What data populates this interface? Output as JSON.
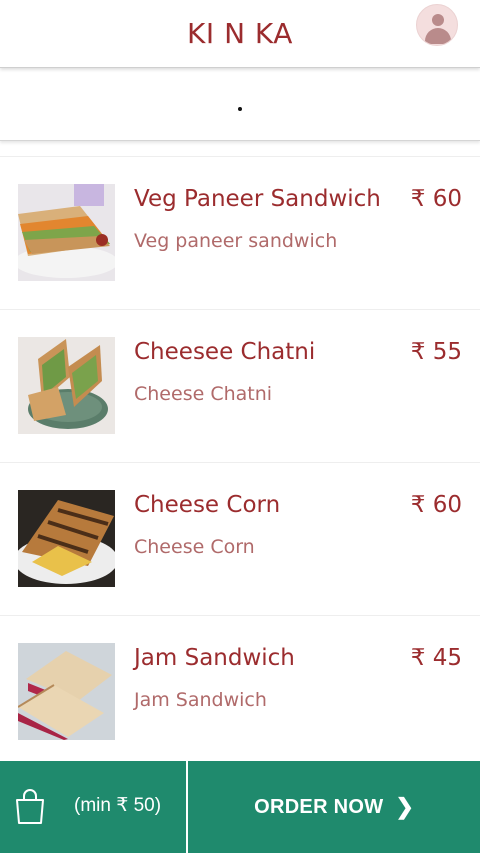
{
  "header": {
    "brand": "KI N KA",
    "avatar_icon": "user-avatar-icon"
  },
  "subbar": {
    "indicator": "."
  },
  "menu_items": [
    {
      "name": "Veg Paneer Sandwich",
      "description": "Veg paneer sandwich",
      "price": "₹ 60"
    },
    {
      "name": "Cheesee Chatni",
      "description": "Cheese Chatni",
      "price": "₹ 55"
    },
    {
      "name": "Cheese Corn",
      "description": "Cheese Corn",
      "price": "₹ 60"
    },
    {
      "name": "Jam Sandwich",
      "description": "Jam Sandwich",
      "price": "₹ 45"
    }
  ],
  "footer": {
    "min_label": "(min ₹ 50)",
    "order_label": "ORDER NOW",
    "order_chevron": "❯",
    "bag_icon": "shopping-bag-icon"
  },
  "colors": {
    "brand": "#9b2c2e",
    "description": "#b06a6a",
    "footer": "#1f8a6d"
  }
}
